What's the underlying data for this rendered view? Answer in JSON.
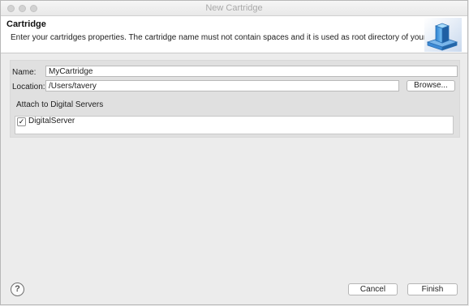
{
  "window": {
    "title": "New Cartridge"
  },
  "header": {
    "title": "Cartridge",
    "description": "Enter your cartridges properties. The cartridge name must not contain spaces and it is used as root directory of your cartridge.",
    "icon": "cartridge-wizard-icon"
  },
  "form": {
    "name_label": "Name:",
    "name_value": "MyCartridge",
    "location_label": "Location:",
    "location_value": "/Users/tavery",
    "browse_label": "Browse..."
  },
  "servers": {
    "title": "Attach to Digital Servers",
    "items": [
      {
        "label": "DigitalServer",
        "checked": true,
        "check_glyph": "✓"
      }
    ]
  },
  "footer": {
    "help_glyph": "?",
    "cancel_label": "Cancel",
    "finish_label": "Finish"
  }
}
